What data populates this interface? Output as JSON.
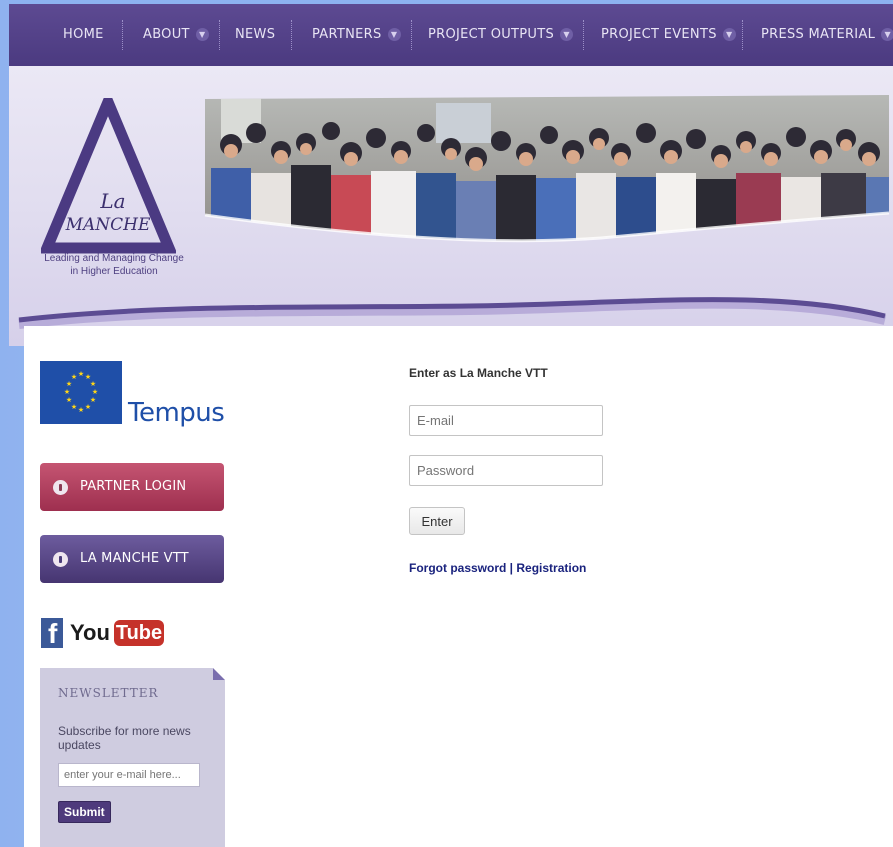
{
  "nav": {
    "items": [
      {
        "label": "HOME",
        "dropdown": false
      },
      {
        "label": "ABOUT",
        "dropdown": true
      },
      {
        "label": "NEWS",
        "dropdown": false
      },
      {
        "label": "PARTNERS",
        "dropdown": true
      },
      {
        "label": "PROJECT OUTPUTS",
        "dropdown": true
      },
      {
        "label": "PROJECT EVENTS",
        "dropdown": true
      },
      {
        "label": "PRESS MATERIAL",
        "dropdown": true
      }
    ]
  },
  "header": {
    "logo": {
      "line1": "La",
      "line2": "MANCHE"
    },
    "tagline_line1": "Leading and Managing Change",
    "tagline_line2": "in Higher Education"
  },
  "sidebar": {
    "tempus_label": "Tempus",
    "partner_login_label": "PARTNER LOGIN",
    "vtt_label": "LA MANCHE VTT",
    "youtube_you": "You",
    "youtube_tube": "Tube",
    "newsletter": {
      "title": "NEWSLETTER",
      "description": "Subscribe for more news updates",
      "placeholder": "enter your e-mail here...",
      "submit_label": "Submit"
    }
  },
  "form": {
    "title": "Enter as La Manche VTT",
    "email_placeholder": "E-mail",
    "password_placeholder": "Password",
    "enter_label": "Enter",
    "forgot_label": "Forgot password",
    "separator": " | ",
    "registration_label": "Registration"
  },
  "colors": {
    "nav_bg": "#4b3a80",
    "accent_purple": "#4e3a7c",
    "partner_button": "#a93555",
    "link": "#1a237e",
    "eu_blue": "#1f4fa8"
  }
}
